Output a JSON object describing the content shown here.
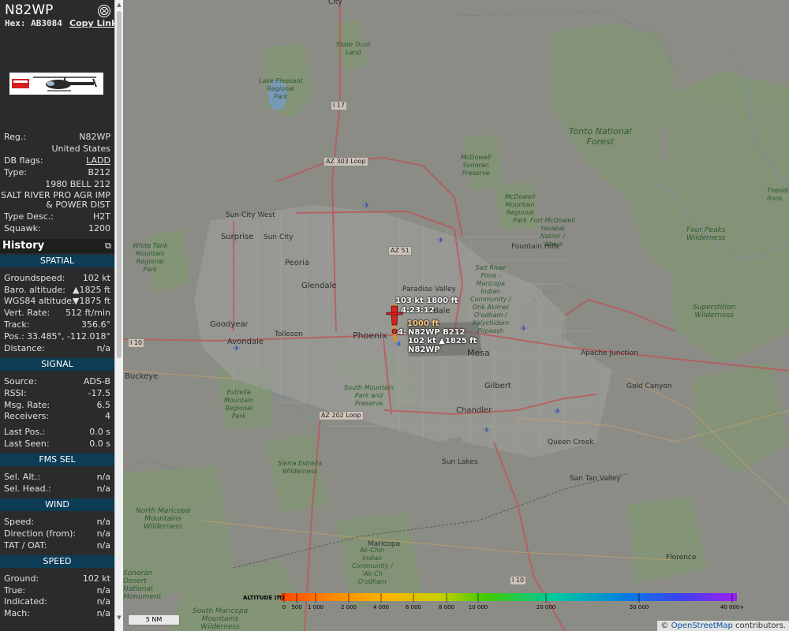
{
  "aircraft": {
    "title": "N82WP",
    "hex_label": "Hex:",
    "hex_value": "AB3084",
    "copy_link": "Copy Link",
    "close_symbol": "⨂"
  },
  "info": {
    "reg_label": "Reg.:",
    "reg_value": "N82WP",
    "country": "United States",
    "dbflags_label": "DB flags:",
    "dbflags_value": "LADD",
    "type_label": "Type:",
    "type_value": "B212",
    "type_full": "1980 BELL 212",
    "owner_line1": "SALT RIVER PRO AGR IMP",
    "owner_line2": "& POWER DIST",
    "typedesc_label": "Type Desc.:",
    "typedesc_value": "H2T",
    "squawk_label": "Squawk:",
    "squawk_value": "1200"
  },
  "history": {
    "title": "History",
    "icon": "⧉"
  },
  "spatial": {
    "title": "SPATIAL",
    "groundspeed_label": "Groundspeed:",
    "groundspeed_value": "102 kt",
    "baro_label": "Baro. altitude:",
    "baro_value": "▲1825 ft",
    "wgs_label": "WGS84 altitude:",
    "wgs_value": "▼1875 ft",
    "vrate_label": "Vert. Rate:",
    "vrate_value": "512 ft/min",
    "track_label": "Track:",
    "track_value": "356.6°",
    "pos_label": "Pos.:",
    "pos_value": "33.485°, -112.018°",
    "dist_label": "Distance:",
    "dist_value": "n/a"
  },
  "signal": {
    "title": "SIGNAL",
    "source_label": "Source:",
    "source_value": "ADS-B",
    "rssi_label": "RSSI:",
    "rssi_value": "-17.5",
    "msg_label": "Msg. Rate:",
    "msg_value": "6.5",
    "recv_label": "Receivers:",
    "recv_value": "4",
    "lastpos_label": "Last Pos.:",
    "lastpos_value": "0.0 s",
    "lastseen_label": "Last Seen:",
    "lastseen_value": "0.0 s"
  },
  "fms": {
    "title": "FMS SEL",
    "alt_label": "Sel. Alt.:",
    "alt_value": "n/a",
    "head_label": "Sel. Head.:",
    "head_value": "n/a"
  },
  "wind": {
    "title": "WIND",
    "speed_label": "Speed:",
    "speed_value": "n/a",
    "dir_label": "Direction (from):",
    "dir_value": "n/a",
    "tat_label": "TAT / OAT:",
    "tat_value": "n/a"
  },
  "speed": {
    "title": "SPEED",
    "ground_label": "Ground:",
    "ground_value": "102 kt",
    "true_label": "True:",
    "true_value": "n/a",
    "ind_label": "Indicated:",
    "ind_value": "n/a",
    "mach_label": "Mach:",
    "mach_value": "n/a"
  },
  "map": {
    "track_label_1": "103 kt  1800 ft",
    "track_label_2": "4:23:12",
    "track_label_3": "1000 ft",
    "track_label_4": "4:",
    "ac_label_1": "N82WP B212",
    "ac_label_2": "102 kt  ▲1825 ft",
    "ac_label_3": "N82WP",
    "places": {
      "city": "City",
      "state_trust": "State Trust\nLand",
      "lake_pleasant": "Lake Pleasant\nRegional\nPark",
      "tonto": "Tonto National\nForest",
      "mcdowell_sonoran": "McDowell\nSonoran\nPreserve",
      "mcdowell_mountain": "McDowell\nMountain\nRegional\nPark",
      "fort_mcdowell": "Fort McDowell\nYavapai\nNation /\n'Abaja",
      "four_peaks": "Four Peaks\nWilderness",
      "theodore": "Theodo\nRoos",
      "sun_city_west": "Sun City West",
      "surprise": "Surprise",
      "sun_city": "Sun City",
      "white_tank": "White Tank\nMountain\nRegional\nPark",
      "peoria": "Peoria",
      "glendale": "Glendale",
      "fountain_hills": "Fountain Hills",
      "paradise_valley": "Paradise Valley",
      "scottsdale": "sdale",
      "salt_river": "Salt River\nPima -\nMaricopa\nIndian\nCommunity /\nOnk Akimel\nO'odham /\nXalychidom\nPiipaash",
      "superstition": "Superstition\nWilderness",
      "goodyear": "Goodyear",
      "avondale": "Avondale",
      "tolleson": "Tolleson",
      "phoenix": "Phoenix",
      "mesa": "Mesa",
      "apache_junction": "Apache Junction",
      "buckeye": "Buckeye",
      "estrella": "Estrella\nMountain\nRegional\nPark",
      "south_mountain": "South Mountain\nPark and\nPreserve",
      "gilbert": "Gilbert",
      "gold_canyon": "Gold Canyon",
      "chandler": "Chandler",
      "queen_creek": "Queen Creek",
      "sierra_estrella": "Sierra Estrella\nWilderness",
      "sun_lakes": "Sun Lakes",
      "san_tan_valley": "San Tan Valley",
      "north_maricopa": "North Maricopa\nMountains\nWilderness",
      "maricopa": "Maricopa",
      "ak_chin": "Ak-Chin\nIndian\nCommunity /\n'Ak-Ch\nO'odham",
      "florence": "Florence",
      "sonoran_desert": "Sonoran\nDesert\nNational\nMonument",
      "south_maricopa": "South Maricopa\nMountains\nWilderness"
    },
    "roads": {
      "i17": "I 17",
      "az303": "AZ 303 Loop",
      "az51": "AZ 51",
      "i10w": "I 10",
      "az202": "AZ 202 Loop",
      "i10s": "I 10"
    },
    "scale": "5 NM",
    "attribution_symbol": "©",
    "attribution_link": "OpenStreetMap",
    "attribution_rest": "contributors."
  },
  "legend": {
    "title": "ALTITUDE (ft)",
    "ticks": [
      "0",
      "500",
      "1 000",
      "2 000",
      "4 000",
      "6 000",
      "8 000",
      "10 000",
      "20 000",
      "30 000",
      "40 000+"
    ]
  },
  "colors": {
    "sidebar_bg": "#2b2b2b",
    "section_bg": "#0d3c57",
    "aircraft_marker": "#e02020",
    "track_low": "#ff8c00",
    "park_green": "#6f8f5c"
  }
}
